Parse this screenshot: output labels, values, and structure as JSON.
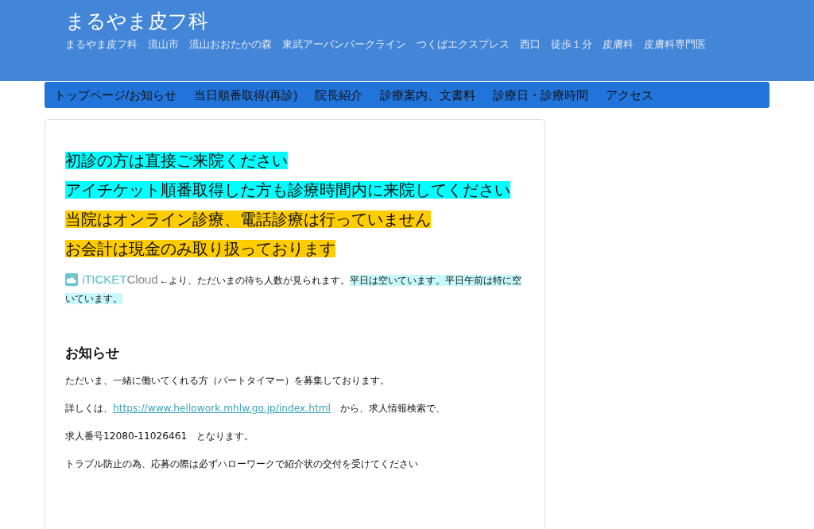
{
  "header": {
    "title": "まるやま皮フ科",
    "tagline": "まるやま皮フ科　流山市　流山おおたかの森　東武アーバンパークライン　つくばエクスプレス　西口　徒歩１分　皮膚科　皮膚科専門医"
  },
  "nav": {
    "items": [
      {
        "label": "トップページ/お知らせ"
      },
      {
        "label": "当日順番取得(再診)"
      },
      {
        "label": "院長紹介"
      },
      {
        "label": "診療案内、文書料"
      },
      {
        "label": "診療日・診療時間"
      },
      {
        "label": "アクセス"
      }
    ]
  },
  "content": {
    "notices": [
      {
        "text": "初診の方は直接ご来院ください",
        "color": "#00ffff"
      },
      {
        "text": "アイチケット順番取得した方も診療時間内に来院してください",
        "color": "#00ffff"
      },
      {
        "text": "当院はオンライン診療、電話診療は行っていません",
        "color": "#ffcc00"
      },
      {
        "text": "お会計は現金のみ取り扱っております",
        "color": "#ffcc00"
      }
    ],
    "ticket_info": {
      "logo": {
        "brand": "iTICKET",
        "suffix": "Cloud"
      },
      "text": "←より、ただいまの待ち人数が見られます。",
      "highlight": "平日は空いています。平日午前は特に空いています。"
    },
    "section": {
      "title": "お知らせ",
      "paragraphs": [
        {
          "kind": "text",
          "text": "ただいま、一緒に働いてくれる方（パートタイマー）を募集しております。"
        },
        {
          "kind": "link",
          "before": "詳しくは、",
          "link": "https://www.hellowork.mhlw.go.jp/index.html",
          "after": "　から、求人情報検索で、"
        },
        {
          "kind": "text",
          "text": "求人番号12080-11026461　となります。"
        },
        {
          "kind": "text",
          "text": "トラブル防止の為、応募の際は必ずハローワークで紹介状の交付を受けてください"
        }
      ]
    }
  }
}
